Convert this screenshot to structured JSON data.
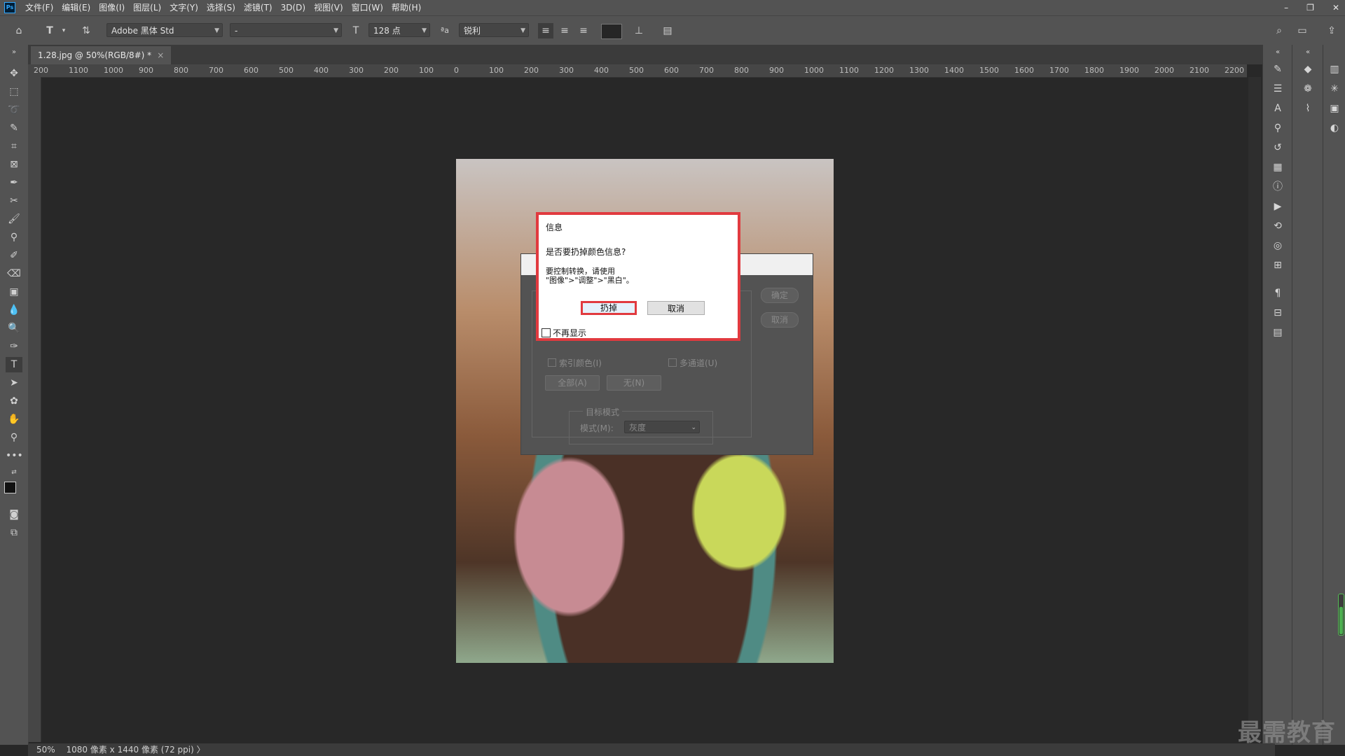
{
  "menubar": {
    "logo": "Ps",
    "items": [
      "文件(F)",
      "编辑(E)",
      "图像(I)",
      "图层(L)",
      "文字(Y)",
      "选择(S)",
      "滤镜(T)",
      "3D(D)",
      "视图(V)",
      "窗口(W)",
      "帮助(H)"
    ],
    "window_controls": [
      "–",
      "❐",
      "✕"
    ]
  },
  "options": {
    "font_family": "Adobe 黑体 Std",
    "font_style": "-",
    "font_size": "128 点",
    "aa_label": "ªa",
    "antialias": "锐利",
    "color_swatch": "#262626"
  },
  "tab": {
    "title": "1.28.jpg @ 50%(RGB/8#) *",
    "close": "×"
  },
  "ruler": {
    "ticks": [
      "200",
      "1100",
      "1000",
      "900",
      "800",
      "700",
      "600",
      "500",
      "400",
      "300",
      "200",
      "100",
      "0",
      "100",
      "200",
      "300",
      "400",
      "500",
      "600",
      "700",
      "800",
      "900",
      "1000",
      "1100",
      "1200",
      "1300",
      "1400",
      "1500",
      "1600",
      "1700",
      "1800",
      "1900",
      "2000",
      "2100",
      "2200"
    ]
  },
  "status": {
    "zoom": "50%",
    "doc_info": "1080 像素 x 1440 像素 (72 ppi)",
    "arrow": "〉"
  },
  "bg_dialog": {
    "ok": "确定",
    "cancel": "取消",
    "indexed": "索引颜色(I)",
    "multichannel": "多通道(U)",
    "all": "全部(A)",
    "none": "无(N)",
    "target_mode": "目标模式",
    "mode_label": "模式(M):",
    "mode_value": "灰度"
  },
  "info_dialog": {
    "title": "信息",
    "question": "是否要扔掉颜色信息?",
    "hint_line1": "要控制转换，请使用",
    "hint_line2": "\"图像\">\"调整\">\"黑白\"。",
    "discard": "扔掉",
    "cancel": "取消",
    "dont_show": "不再显示",
    "highlight_color": "#e13a3f"
  },
  "level_indicator": {
    "fill_percent": 70
  },
  "watermark": "最需教育"
}
